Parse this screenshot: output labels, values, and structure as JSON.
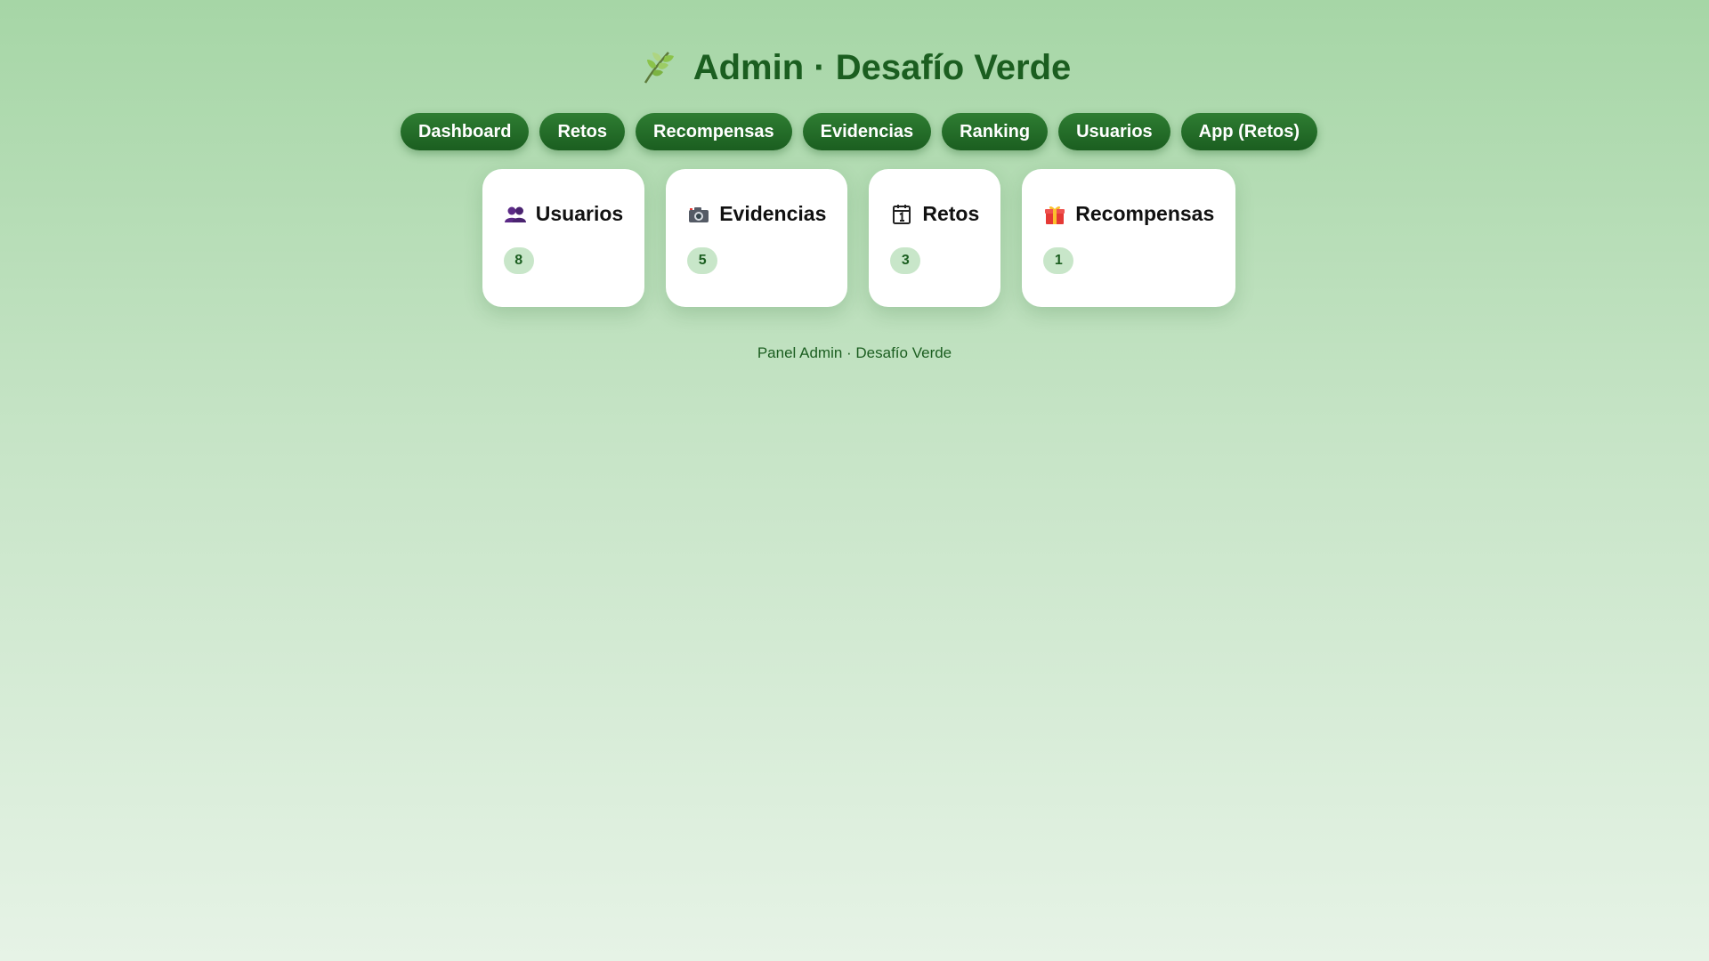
{
  "header": {
    "logo_icon": "leaf-icon",
    "title": "Admin · Desafío Verde"
  },
  "nav": {
    "items": [
      {
        "label": "Dashboard"
      },
      {
        "label": "Retos"
      },
      {
        "label": "Recompensas"
      },
      {
        "label": "Evidencias"
      },
      {
        "label": "Ranking"
      },
      {
        "label": "Usuarios"
      },
      {
        "label": "App (Retos)"
      }
    ]
  },
  "stats": [
    {
      "icon": "users-icon",
      "label": "Usuarios",
      "count": "8"
    },
    {
      "icon": "camera-icon",
      "label": "Evidencias",
      "count": "5"
    },
    {
      "icon": "calendar-icon",
      "label": "Retos",
      "count": "3"
    },
    {
      "icon": "gift-icon",
      "label": "Recompensas",
      "count": "1"
    }
  ],
  "footer": {
    "text": "Panel Admin · Desafío Verde"
  },
  "colors": {
    "primary": "#1b5e20",
    "button": "#2e7d32",
    "badge_bg": "#c8e6c9",
    "card_bg": "#ffffff"
  }
}
